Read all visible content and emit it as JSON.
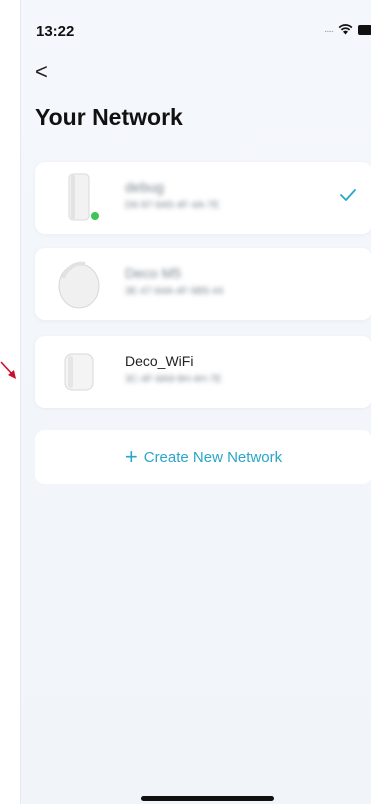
{
  "status_bar": {
    "time": "13:22",
    "signal_dots": "....."
  },
  "header": {
    "back_symbol": "<",
    "title": "Your Network"
  },
  "networks": [
    {
      "name": "debug",
      "mac": "D6-97-6A5-4F-4A-7E",
      "blurred": true,
      "selected": true,
      "online": true
    },
    {
      "name": "Deco M5",
      "mac": "3E-47-84A-4F-9B5-44",
      "blurred": true,
      "selected": false,
      "online": false
    },
    {
      "name": "Deco_WiFi",
      "mac": "3C-4F-8A9-9H-4H-7E",
      "blurred": false,
      "selected": false,
      "online": false
    }
  ],
  "create": {
    "plus": "+",
    "label": "Create New Network"
  },
  "colors": {
    "accent": "#2aa6c8",
    "online_dot": "#3cc65a",
    "arrow": "#c8102e"
  }
}
